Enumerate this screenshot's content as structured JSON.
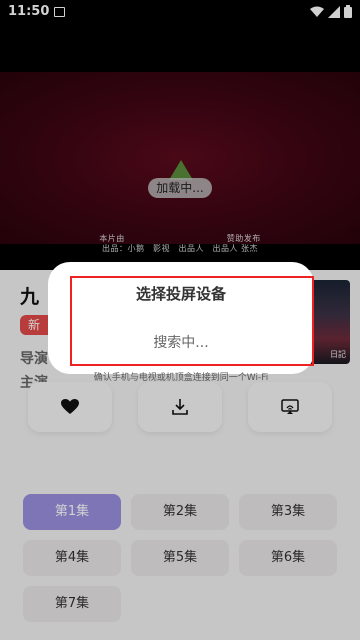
{
  "status_bar": {
    "time": "11:50"
  },
  "video": {
    "loading_label": "加载中...",
    "credits_line1": "本片由　　　　　　　　　　　　赞助发布",
    "credits_line2": "出品：小鹅　影视　出品人　出品人 张杰"
  },
  "movie": {
    "title": "九",
    "tag": "新",
    "director_label": "导演",
    "actor_label": "主演",
    "poster_caption": "日記"
  },
  "actions": {
    "like": "heart-icon",
    "download": "download-icon",
    "cast": "cast-icon"
  },
  "episodes": [
    {
      "label": "第1集",
      "active": true
    },
    {
      "label": "第2集",
      "active": false
    },
    {
      "label": "第3集",
      "active": false
    },
    {
      "label": "第4集",
      "active": false
    },
    {
      "label": "第5集",
      "active": false
    },
    {
      "label": "第6集",
      "active": false
    },
    {
      "label": "第7集",
      "active": false
    }
  ],
  "dialog": {
    "title": "选择投屏设备",
    "status": "搜索中...",
    "hint": "确认手机与电视或机顶盒连接到同一个Wi-Fi"
  },
  "colors": {
    "accent": "#9a8fe0",
    "tag": "#e14a4a",
    "highlight": "#ee2222"
  }
}
